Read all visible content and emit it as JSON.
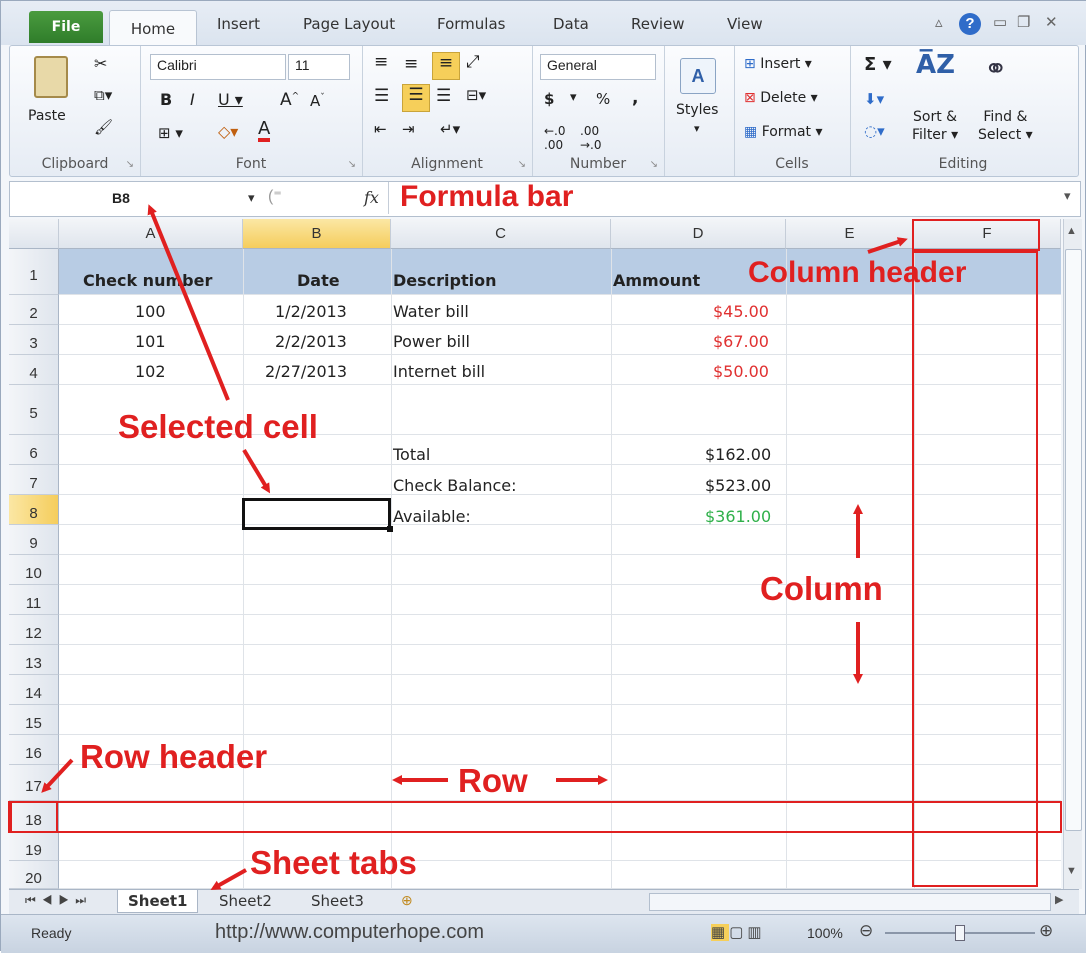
{
  "tabs": [
    "File",
    "Home",
    "Insert",
    "Page Layout",
    "Formulas",
    "Data",
    "Review",
    "View"
  ],
  "ribbon": {
    "clipboard": {
      "paste": "Paste",
      "label": "Clipboard"
    },
    "font": {
      "name": "Calibri",
      "size": "11",
      "label": "Font"
    },
    "alignment": {
      "label": "Alignment"
    },
    "number": {
      "format": "General",
      "dollar": "$",
      "percent": "%",
      "comma": ",",
      "label": "Number"
    },
    "styles": {
      "label": "Styles"
    },
    "cells": {
      "insert": "Insert",
      "delete": "Delete",
      "format": "Format",
      "label": "Cells"
    },
    "editing": {
      "sigma": "Σ",
      "sort": "Sort &",
      "sort2": "Filter",
      "find": "Find &",
      "find2": "Select",
      "label": "Editing"
    }
  },
  "formula_bar": {
    "name_box": "B8",
    "fx": "fx"
  },
  "columns": [
    "A",
    "B",
    "C",
    "D",
    "E",
    "F"
  ],
  "rows": [
    "1",
    "2",
    "3",
    "4",
    "5",
    "6",
    "7",
    "8",
    "9",
    "10",
    "11",
    "12",
    "13",
    "14",
    "15",
    "16",
    "17",
    "18",
    "19",
    "20"
  ],
  "table": {
    "headers": [
      "Check number",
      "Date",
      "Description",
      "Ammount"
    ],
    "data": [
      {
        "check": "100",
        "date": "1/2/2013",
        "desc": "Water bill",
        "amount": "$45.00"
      },
      {
        "check": "101",
        "date": "2/2/2013",
        "desc": "Power bill",
        "amount": "$67.00"
      },
      {
        "check": "102",
        "date": "2/27/2013",
        "desc": "Internet bill",
        "amount": "$50.00"
      }
    ],
    "total_label": "Total",
    "total": "$162.00",
    "balance_label": "Check Balance:",
    "balance": "$523.00",
    "available_label": "Available:",
    "available": "$361.00"
  },
  "sheets": [
    "Sheet1",
    "Sheet2",
    "Sheet3"
  ],
  "status": {
    "ready": "Ready",
    "url": "http://www.computerhope.com",
    "zoom": "100%"
  },
  "annotations": {
    "formula_bar": "Formula bar",
    "column_header": "Column header",
    "selected_cell": "Selected cell",
    "column": "Column",
    "row_header": "Row header",
    "row": "Row",
    "sheet_tabs": "Sheet tabs"
  },
  "colors": {
    "accent_red": "#e02020",
    "header_fill": "#b8cce4",
    "negative": "#e03030",
    "positive": "#2fb04a"
  }
}
